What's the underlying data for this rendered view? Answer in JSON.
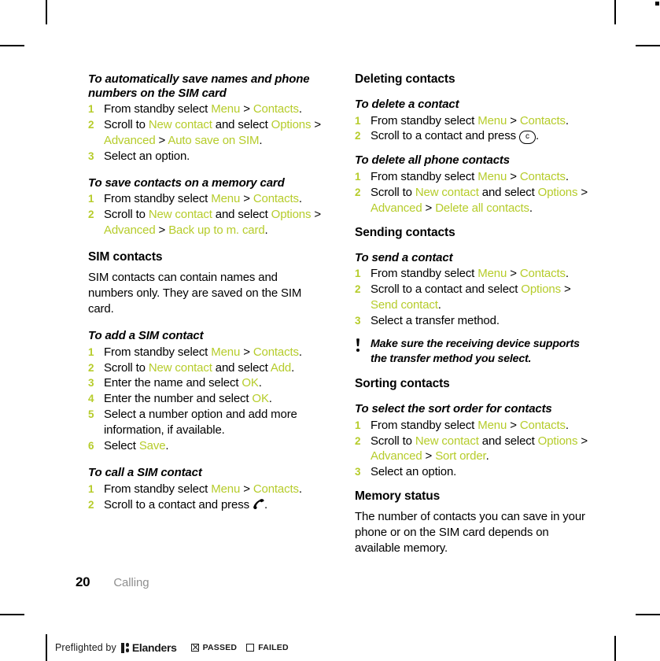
{
  "accent_color": "#b6cc2b",
  "page": {
    "folio": "20",
    "chapter": "Calling"
  },
  "left_column": [
    {
      "kind": "heading3",
      "text": "To automatically save names and phone numbers on the SIM card"
    },
    {
      "kind": "steps",
      "items": [
        {
          "segments": [
            {
              "t": "From standby select ",
              "s": "plain"
            },
            {
              "t": "Menu",
              "s": "accent"
            },
            {
              "t": " > ",
              "s": "plain"
            },
            {
              "t": "Contacts",
              "s": "accent"
            },
            {
              "t": ".",
              "s": "plain"
            }
          ]
        },
        {
          "segments": [
            {
              "t": "Scroll to ",
              "s": "plain"
            },
            {
              "t": "New contact",
              "s": "accent"
            },
            {
              "t": " and select ",
              "s": "plain"
            },
            {
              "t": "Options",
              "s": "accent"
            },
            {
              "t": " > ",
              "s": "plain"
            },
            {
              "t": "Advanced",
              "s": "accent"
            },
            {
              "t": " > ",
              "s": "plain"
            },
            {
              "t": "Auto save on SIM",
              "s": "accent"
            },
            {
              "t": ".",
              "s": "plain"
            }
          ]
        },
        {
          "segments": [
            {
              "t": "Select an option.",
              "s": "plain"
            }
          ]
        }
      ]
    },
    {
      "kind": "gap",
      "size": "gap-l"
    },
    {
      "kind": "heading3",
      "text": "To save contacts on a memory card"
    },
    {
      "kind": "steps",
      "items": [
        {
          "segments": [
            {
              "t": "From standby select ",
              "s": "plain"
            },
            {
              "t": "Menu",
              "s": "accent"
            },
            {
              "t": " > ",
              "s": "plain"
            },
            {
              "t": "Contacts",
              "s": "accent"
            },
            {
              "t": ".",
              "s": "plain"
            }
          ]
        },
        {
          "segments": [
            {
              "t": "Scroll to ",
              "s": "plain"
            },
            {
              "t": "New contact",
              "s": "accent"
            },
            {
              "t": " and select ",
              "s": "plain"
            },
            {
              "t": "Options",
              "s": "accent"
            },
            {
              "t": " > ",
              "s": "plain"
            },
            {
              "t": "Advanced",
              "s": "accent"
            },
            {
              "t": " > ",
              "s": "plain"
            },
            {
              "t": "Back up to m. card",
              "s": "accent"
            },
            {
              "t": ".",
              "s": "plain"
            }
          ]
        }
      ]
    },
    {
      "kind": "gap",
      "size": "gap-l"
    },
    {
      "kind": "heading2",
      "text": "SIM contacts"
    },
    {
      "kind": "paragraph",
      "text": "SIM contacts can contain names and numbers only. They are saved on the SIM card."
    },
    {
      "kind": "gap",
      "size": "gap-l"
    },
    {
      "kind": "heading3",
      "text": "To add a SIM contact"
    },
    {
      "kind": "steps",
      "items": [
        {
          "segments": [
            {
              "t": "From standby select ",
              "s": "plain"
            },
            {
              "t": "Menu",
              "s": "accent"
            },
            {
              "t": " > ",
              "s": "plain"
            },
            {
              "t": "Contacts",
              "s": "accent"
            },
            {
              "t": ".",
              "s": "plain"
            }
          ]
        },
        {
          "segments": [
            {
              "t": "Scroll to ",
              "s": "plain"
            },
            {
              "t": "New contact",
              "s": "accent"
            },
            {
              "t": " and select ",
              "s": "plain"
            },
            {
              "t": "Add",
              "s": "accent"
            },
            {
              "t": ".",
              "s": "plain"
            }
          ]
        },
        {
          "segments": [
            {
              "t": "Enter the name and select ",
              "s": "plain"
            },
            {
              "t": "OK",
              "s": "accent"
            },
            {
              "t": ".",
              "s": "plain"
            }
          ]
        },
        {
          "segments": [
            {
              "t": "Enter the number and select ",
              "s": "plain"
            },
            {
              "t": "OK",
              "s": "accent"
            },
            {
              "t": ".",
              "s": "plain"
            }
          ]
        },
        {
          "segments": [
            {
              "t": "Select a number option and add more information, if available.",
              "s": "plain"
            }
          ]
        },
        {
          "segments": [
            {
              "t": "Select ",
              "s": "plain"
            },
            {
              "t": "Save",
              "s": "accent"
            },
            {
              "t": ".",
              "s": "plain"
            }
          ]
        }
      ]
    },
    {
      "kind": "gap",
      "size": "gap-l"
    },
    {
      "kind": "heading3",
      "text": "To call a SIM contact"
    },
    {
      "kind": "steps",
      "items": [
        {
          "segments": [
            {
              "t": "From standby select ",
              "s": "plain"
            },
            {
              "t": "Menu",
              "s": "accent"
            },
            {
              "t": " > ",
              "s": "plain"
            },
            {
              "t": "Contacts",
              "s": "accent"
            },
            {
              "t": ".",
              "s": "plain"
            }
          ]
        },
        {
          "segments": [
            {
              "t": "Scroll to a contact and press ",
              "s": "plain"
            },
            {
              "t": "",
              "s": "icon-call"
            },
            {
              "t": ".",
              "s": "plain"
            }
          ]
        }
      ]
    }
  ],
  "right_column": [
    {
      "kind": "heading2",
      "text": "Deleting contacts"
    },
    {
      "kind": "gap",
      "size": "gap-s"
    },
    {
      "kind": "heading3",
      "text": "To delete a contact"
    },
    {
      "kind": "steps",
      "items": [
        {
          "segments": [
            {
              "t": "From standby select ",
              "s": "plain"
            },
            {
              "t": "Menu",
              "s": "accent"
            },
            {
              "t": " > ",
              "s": "plain"
            },
            {
              "t": "Contacts",
              "s": "accent"
            },
            {
              "t": ".",
              "s": "plain"
            }
          ]
        },
        {
          "segments": [
            {
              "t": "Scroll to a contact and press ",
              "s": "plain"
            },
            {
              "t": "c",
              "s": "key"
            },
            {
              "t": ".",
              "s": "plain"
            }
          ]
        }
      ]
    },
    {
      "kind": "gap",
      "size": "gap-m"
    },
    {
      "kind": "heading3",
      "text": "To delete all phone contacts"
    },
    {
      "kind": "steps",
      "items": [
        {
          "segments": [
            {
              "t": "From standby select ",
              "s": "plain"
            },
            {
              "t": "Menu",
              "s": "accent"
            },
            {
              "t": " > ",
              "s": "plain"
            },
            {
              "t": "Contacts",
              "s": "accent"
            },
            {
              "t": ".",
              "s": "plain"
            }
          ]
        },
        {
          "segments": [
            {
              "t": "Scroll to ",
              "s": "plain"
            },
            {
              "t": "New contact",
              "s": "accent"
            },
            {
              "t": " and select ",
              "s": "plain"
            },
            {
              "t": "Options",
              "s": "accent"
            },
            {
              "t": " > ",
              "s": "plain"
            },
            {
              "t": "Advanced",
              "s": "accent"
            },
            {
              "t": " > ",
              "s": "plain"
            },
            {
              "t": "Delete all contacts",
              "s": "accent"
            },
            {
              "t": ".",
              "s": "plain"
            }
          ]
        }
      ]
    },
    {
      "kind": "gap",
      "size": "gap-m"
    },
    {
      "kind": "heading2",
      "text": "Sending contacts"
    },
    {
      "kind": "gap",
      "size": "gap-s"
    },
    {
      "kind": "heading3",
      "text": "To send a contact"
    },
    {
      "kind": "steps",
      "items": [
        {
          "segments": [
            {
              "t": "From standby select ",
              "s": "plain"
            },
            {
              "t": "Menu",
              "s": "accent"
            },
            {
              "t": " > ",
              "s": "plain"
            },
            {
              "t": "Contacts",
              "s": "accent"
            },
            {
              "t": ".",
              "s": "plain"
            }
          ]
        },
        {
          "segments": [
            {
              "t": "Scroll to a contact and select ",
              "s": "plain"
            },
            {
              "t": "Options",
              "s": "accent"
            },
            {
              "t": " > ",
              "s": "plain"
            },
            {
              "t": "Send contact",
              "s": "accent"
            },
            {
              "t": ".",
              "s": "plain"
            }
          ]
        },
        {
          "segments": [
            {
              "t": "Select a transfer method.",
              "s": "plain"
            }
          ]
        }
      ]
    },
    {
      "kind": "note",
      "text": "Make sure the receiving device supports the transfer method you select."
    },
    {
      "kind": "gap",
      "size": "gap-m"
    },
    {
      "kind": "heading2",
      "text": "Sorting contacts"
    },
    {
      "kind": "gap",
      "size": "gap-s"
    },
    {
      "kind": "heading3",
      "text": "To select the sort order for contacts"
    },
    {
      "kind": "steps",
      "items": [
        {
          "segments": [
            {
              "t": "From standby select ",
              "s": "plain"
            },
            {
              "t": "Menu",
              "s": "accent"
            },
            {
              "t": " > ",
              "s": "plain"
            },
            {
              "t": "Contacts",
              "s": "accent"
            },
            {
              "t": ".",
              "s": "plain"
            }
          ]
        },
        {
          "segments": [
            {
              "t": "Scroll to ",
              "s": "plain"
            },
            {
              "t": "New contact",
              "s": "accent"
            },
            {
              "t": " and select ",
              "s": "plain"
            },
            {
              "t": "Options",
              "s": "accent"
            },
            {
              "t": " > ",
              "s": "plain"
            },
            {
              "t": "Advanced",
              "s": "accent"
            },
            {
              "t": " > ",
              "s": "plain"
            },
            {
              "t": "Sort order",
              "s": "accent"
            },
            {
              "t": ".",
              "s": "plain"
            }
          ]
        },
        {
          "segments": [
            {
              "t": "Select an option.",
              "s": "plain"
            }
          ]
        }
      ]
    },
    {
      "kind": "gap",
      "size": "gap-m"
    },
    {
      "kind": "heading2",
      "text": "Memory status"
    },
    {
      "kind": "paragraph",
      "text": "The number of contacts you can save in your phone or on the SIM card depends on available memory."
    }
  ],
  "preflight": {
    "prefix": "Preflighted by",
    "brand": "Elanders",
    "passed_label": "PASSED",
    "passed_checked": true,
    "failed_label": "FAILED",
    "failed_checked": false
  }
}
